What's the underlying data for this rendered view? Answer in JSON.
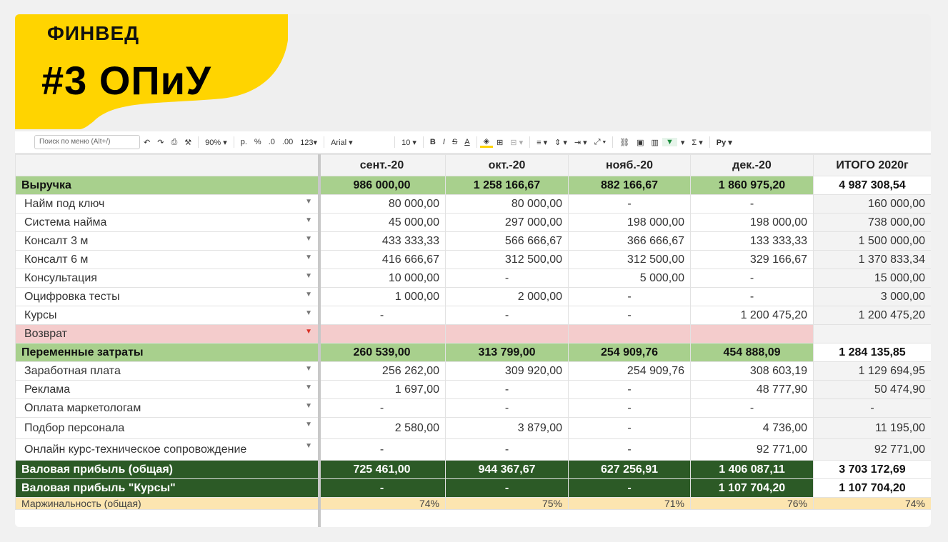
{
  "banner": {
    "brand": "ФИНВЕД",
    "headline": "#3 ОПиУ",
    "accent_color": "#ffd400"
  },
  "toolbar": {
    "search_placeholder": "Поиск по меню (Alt+/)",
    "zoom": "90%",
    "currency": "р.",
    "percent": "%",
    "dec_less": ".0",
    "dec_more": ".00",
    "format": "123",
    "font": "Arial",
    "font_size": "10",
    "bold": "B",
    "italic": "I",
    "strike": "S",
    "text_color": "A",
    "sum": "Σ",
    "input_lang": "Ру"
  },
  "table": {
    "headers": [
      "",
      "сент.-20",
      "окт.-20",
      "нояб.-20",
      "дек.-20",
      "ИТОГО 2020г"
    ],
    "rows": [
      {
        "type": "green",
        "label": "Выручка",
        "values": [
          "986 000,00",
          "1 258 166,67",
          "882 166,67",
          "1 860 975,20",
          "4 987 308,54"
        ]
      },
      {
        "type": "item",
        "label": "Найм под ключ",
        "values": [
          "80 000,00",
          "80 000,00",
          "-",
          "-",
          "160 000,00"
        ]
      },
      {
        "type": "item",
        "label": "Система найма",
        "values": [
          "45 000,00",
          "297 000,00",
          "198 000,00",
          "198 000,00",
          "738 000,00"
        ]
      },
      {
        "type": "item",
        "label": "Консалт 3 м",
        "values": [
          "433 333,33",
          "566 666,67",
          "366 666,67",
          "133 333,33",
          "1 500 000,00"
        ]
      },
      {
        "type": "item",
        "label": "Консалт 6 м",
        "values": [
          "416 666,67",
          "312 500,00",
          "312 500,00",
          "329 166,67",
          "1 370 833,34"
        ]
      },
      {
        "type": "item",
        "label": "Консультация",
        "values": [
          "10 000,00",
          "-",
          "5 000,00",
          "-",
          "15 000,00"
        ]
      },
      {
        "type": "item",
        "label": "Оцифровка тесты",
        "values": [
          "1 000,00",
          "2 000,00",
          "-",
          "-",
          "3 000,00"
        ]
      },
      {
        "type": "item",
        "label": "Курсы",
        "values": [
          "-",
          "-",
          "-",
          "1 200 475,20",
          "1 200 475,20"
        ]
      },
      {
        "type": "pink",
        "label": "Возврат",
        "values": [
          "",
          "",
          "",
          "",
          ""
        ]
      },
      {
        "type": "green",
        "label": "Переменные затраты",
        "values": [
          "260 539,00",
          "313 799,00",
          "254 909,76",
          "454 888,09",
          "1 284 135,85"
        ]
      },
      {
        "type": "item",
        "label": "Заработная плата",
        "values": [
          "256 262,00",
          "309 920,00",
          "254 909,76",
          "308 603,19",
          "1 129 694,95"
        ]
      },
      {
        "type": "item",
        "label": "Реклама",
        "values": [
          "1 697,00",
          "-",
          "-",
          "48 777,90",
          "50 474,90"
        ]
      },
      {
        "type": "item",
        "label": "Оплата маркетологам",
        "values": [
          "-",
          "-",
          "-",
          "-",
          "-"
        ]
      },
      {
        "type": "item-tall",
        "label": "Подбор персонала",
        "values": [
          "2 580,00",
          "3 879,00",
          "-",
          "4 736,00",
          "11 195,00"
        ]
      },
      {
        "type": "item-tall",
        "label": "Онлайн курс-техническое сопровождение",
        "values": [
          "-",
          "-",
          "-",
          "92 771,00",
          "92 771,00"
        ]
      },
      {
        "type": "dark",
        "label": "Валовая прибыль (общая)",
        "values": [
          "725 461,00",
          "944 367,67",
          "627 256,91",
          "1 406 087,11",
          "3 703 172,69"
        ]
      },
      {
        "type": "dark",
        "label": "Валовая прибыль \"Курсы\"",
        "values": [
          "-",
          "-",
          "-",
          "1 107 704,20",
          "1 107 704,20"
        ]
      },
      {
        "type": "yellow",
        "label": "Маржинальность (общая)",
        "values": [
          "74%",
          "75%",
          "71%",
          "76%",
          "74%"
        ]
      }
    ]
  }
}
